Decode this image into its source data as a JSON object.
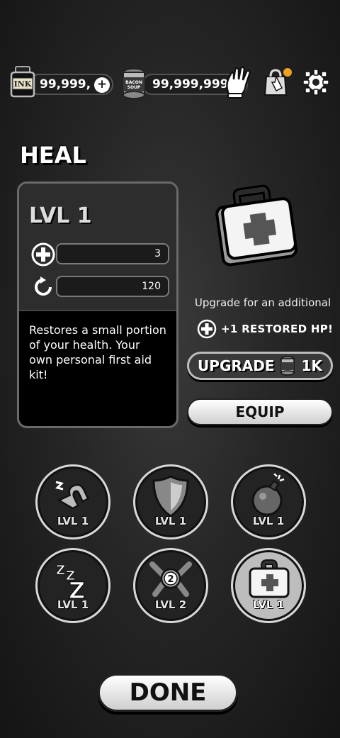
{
  "currency": {
    "ink_amount": "99,999,",
    "bacon_amount": "99,999,999",
    "ink_label": "INK",
    "bacon_label": "BACON SOUP"
  },
  "item": {
    "name": "HEAL",
    "level_label": "LVL 1",
    "stat1_value": "3",
    "stat2_value": "120",
    "description": "Restores a small portion of your health. Your own personal first aid kit!",
    "upgrade_text": "Upgrade for an additional",
    "upgrade_bonus": "+1 RESTORED HP!",
    "upgrade_button_label": "UPGRADE",
    "upgrade_cost": "1K",
    "equip_label": "EQUIP"
  },
  "powerups": [
    {
      "icon": "magnet-icon",
      "level": "LVL 1"
    },
    {
      "icon": "shield-icon",
      "level": "LVL 1"
    },
    {
      "icon": "bomb-icon",
      "level": "LVL 1"
    },
    {
      "icon": "sleep-icon",
      "level": "LVL 1"
    },
    {
      "icon": "wrench-badge-icon",
      "level": "LVL 2"
    },
    {
      "icon": "first-aid-kit-icon",
      "level": "LVL 1",
      "selected": true
    }
  ],
  "done_label": "DONE",
  "colors": {
    "background": "#262626",
    "notification": "#f0a020"
  }
}
